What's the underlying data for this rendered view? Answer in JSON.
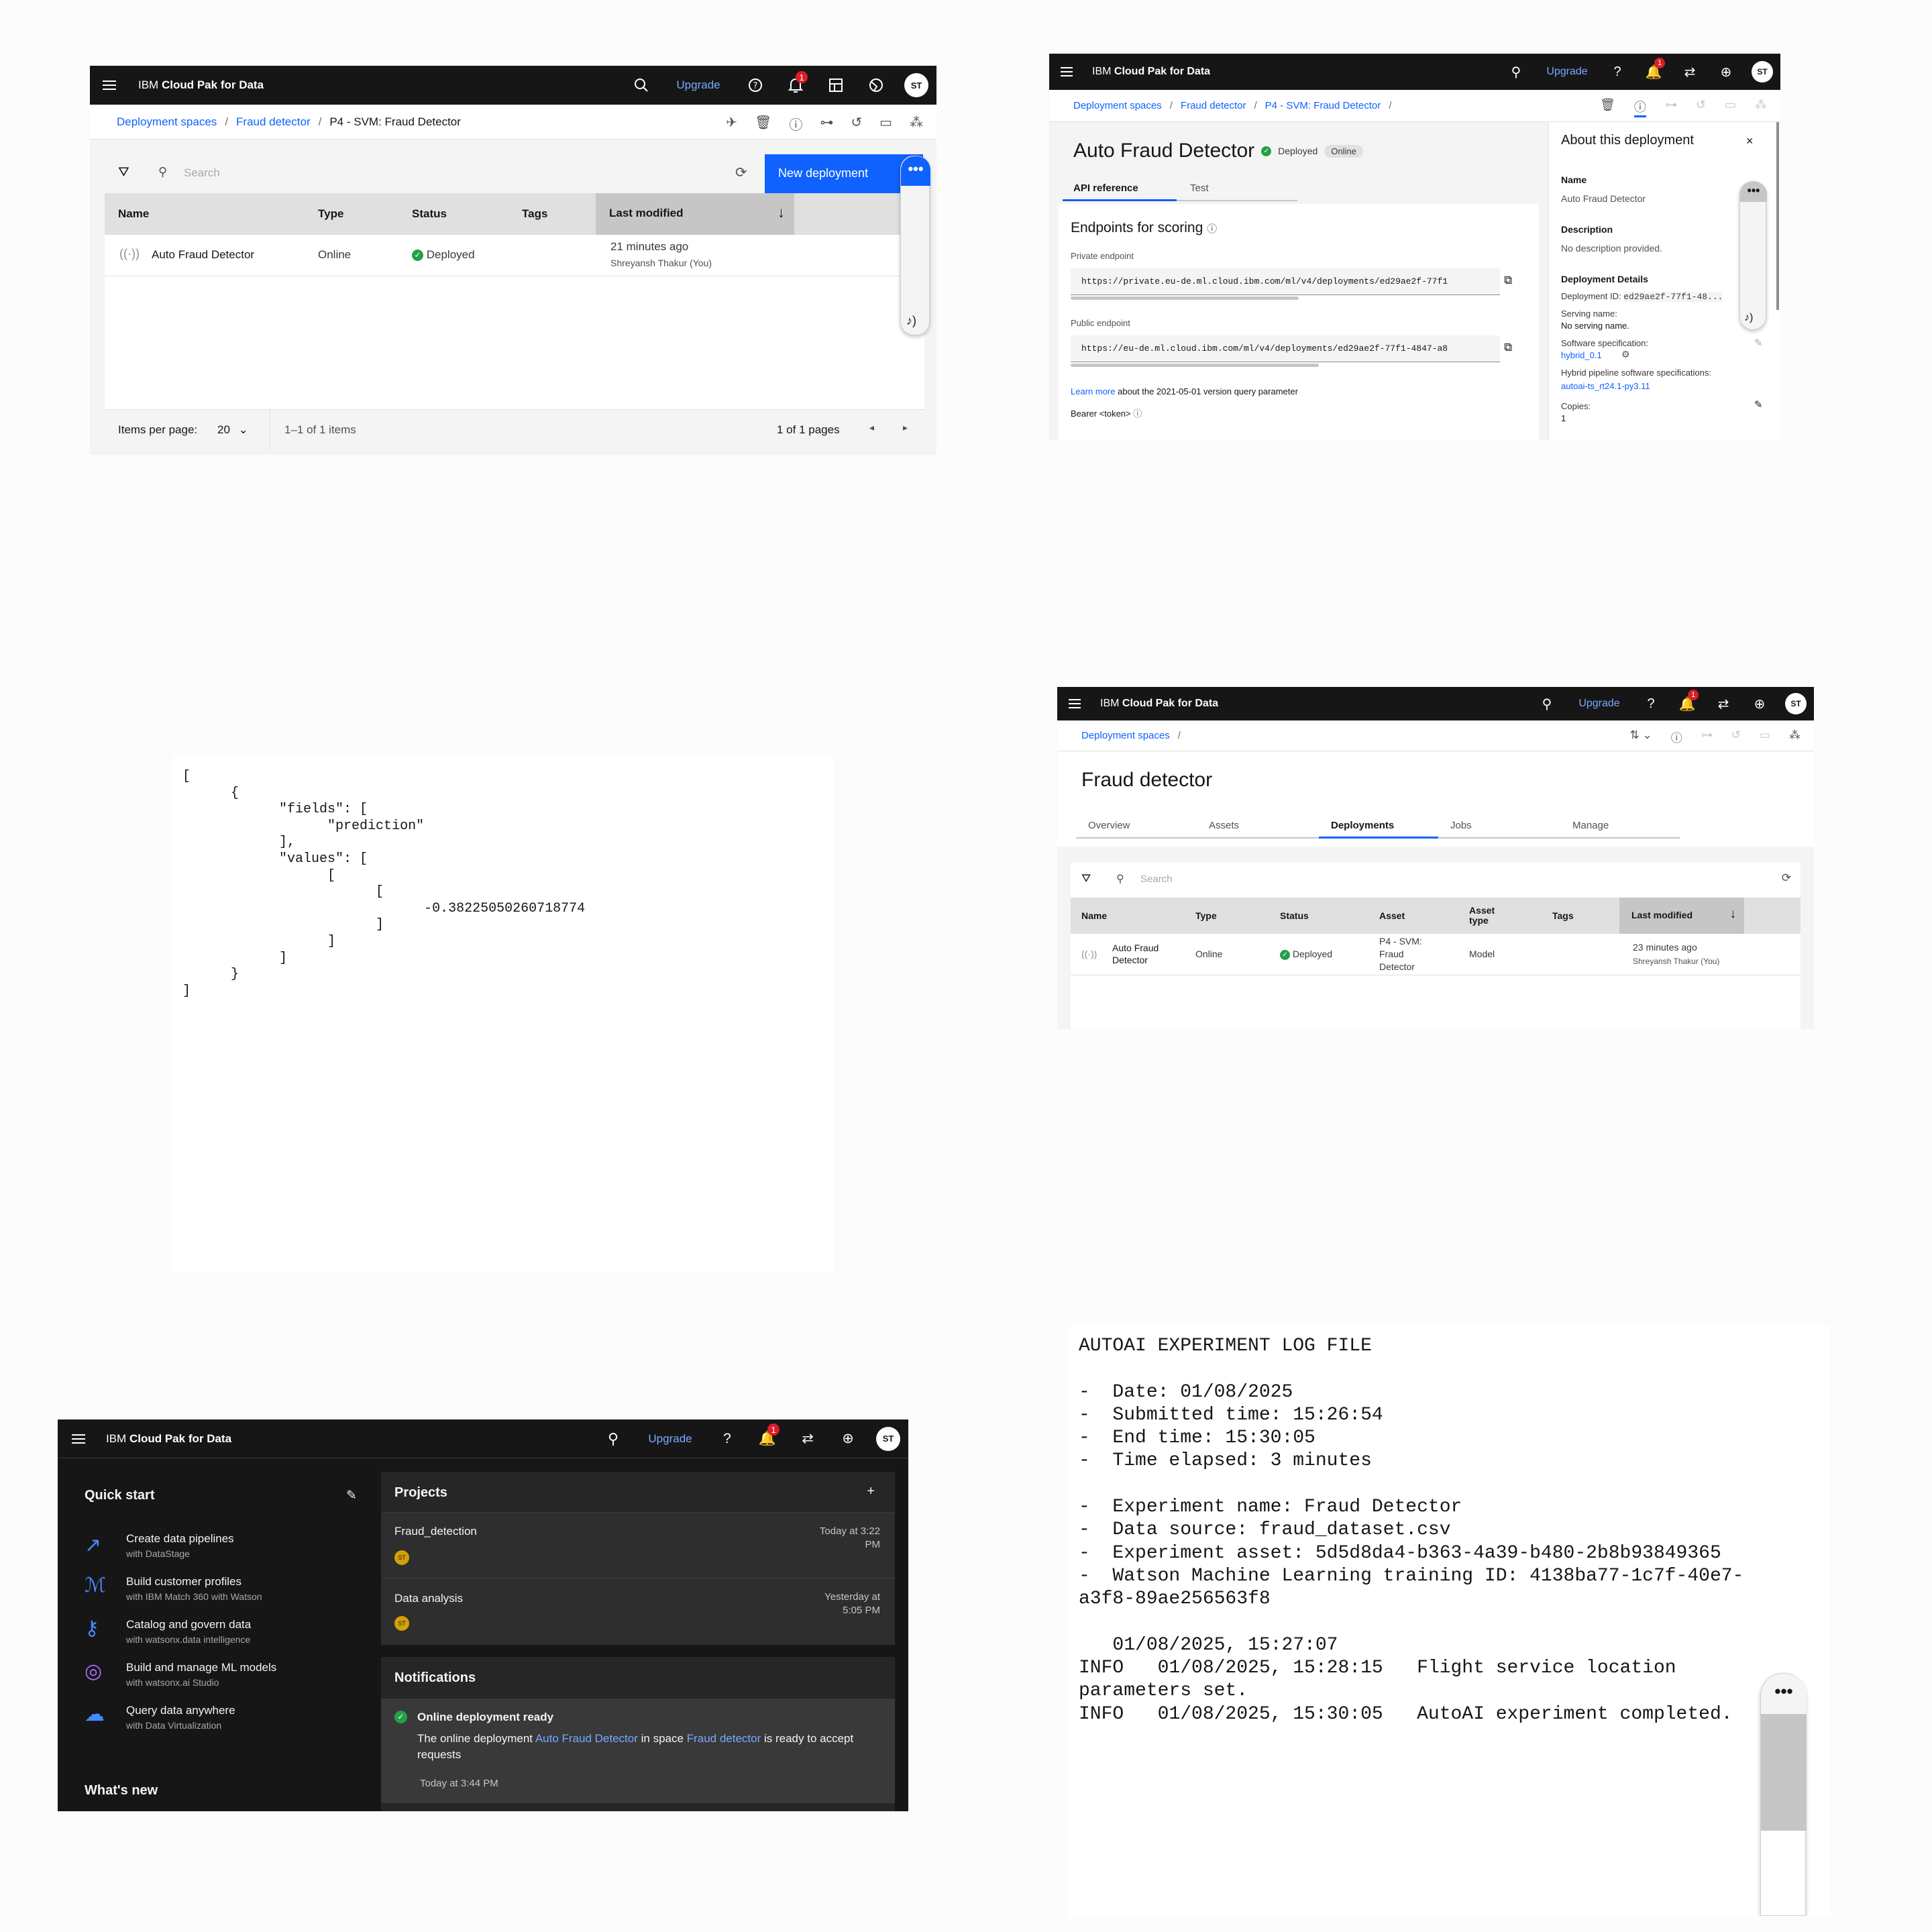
{
  "header": {
    "brand_prefix": "IBM",
    "brand_name": "Cloud Pak for Data",
    "upgrade_label": "Upgrade",
    "notification_count": "1",
    "avatar_initials": "ST"
  },
  "panel1": {
    "breadcrumb": [
      "Deployment spaces",
      "Fraud detector",
      "P4 - SVM: Fraud Detector"
    ],
    "search_placeholder": "Search",
    "new_deployment_label": "New deployment",
    "columns": [
      "Name",
      "Type",
      "Status",
      "Tags",
      "Last modified"
    ],
    "row": {
      "name": "Auto Fraud Detector",
      "type": "Online",
      "status": "Deployed",
      "modified": "21 minutes ago",
      "modified_by": "Shreyansh Thakur (You)"
    },
    "items_per_page_label": "Items per page:",
    "items_per_page_value": "20",
    "range_label": "1–1 of 1 items",
    "pages_label": "1 of 1 pages"
  },
  "panel2": {
    "breadcrumb": [
      "Deployment spaces",
      "Fraud detector",
      "P4 - SVM: Fraud Detector"
    ],
    "title": "Auto Fraud Detector",
    "status": "Deployed",
    "mode_tag": "Online",
    "tabs": [
      "API reference",
      "Test"
    ],
    "endpoints_heading": "Endpoints for scoring",
    "private_label": "Private endpoint",
    "private_url": "https://private.eu-de.ml.cloud.ibm.com/ml/v4/deployments/ed29ae2f-77f1",
    "public_label": "Public endpoint",
    "public_url": "https://eu-de.ml.cloud.ibm.com/ml/v4/deployments/ed29ae2f-77f1-4847-a8",
    "learn_more": "Learn more",
    "learn_more_rest": "about the 2021-05-01 version query parameter",
    "bearer": "Bearer <token>",
    "about": {
      "heading": "About this deployment",
      "name_label": "Name",
      "name_value": "Auto Fraud Detector",
      "desc_label": "Description",
      "desc_value": "No description provided.",
      "details_label": "Deployment Details",
      "id_label": "Deployment ID:",
      "id_value": "ed29ae2f-77f1-48...",
      "serving_label": "Serving name:",
      "serving_value": "No serving name.",
      "software_label": "Software specification:",
      "software_value": "hybrid_0.1",
      "hybrid_label": "Hybrid pipeline software specifications:",
      "hybrid_value": "autoai-ts_rt24.1-py3.11",
      "copies_label": "Copies:",
      "copies_value": "1"
    }
  },
  "panel3": {
    "json_text": "[\n\t{\n\t\t\"fields\": [\n\t\t\t\"prediction\"\n\t\t],\n\t\t\"values\": [\n\t\t\t[\n\t\t\t\t[\n\t\t\t\t\t-0.38225050260718774\n\t\t\t\t]\n\t\t\t]\n\t\t]\n\t}\n]"
  },
  "panel4": {
    "breadcrumb": [
      "Deployment spaces"
    ],
    "title": "Fraud detector",
    "tabs": [
      "Overview",
      "Assets",
      "Deployments",
      "Jobs",
      "Manage"
    ],
    "active_tab": "Deployments",
    "search_placeholder": "Search",
    "columns": [
      "Name",
      "Type",
      "Status",
      "Asset",
      "Asset type",
      "Tags",
      "Last modified"
    ],
    "row": {
      "name": "Auto Fraud Detector",
      "type": "Online",
      "status": "Deployed",
      "asset": "P4 - SVM: Fraud Detector",
      "asset_type": "Model",
      "modified": "23 minutes ago",
      "modified_by": "Shreyansh Thakur (You)"
    }
  },
  "panel5": {
    "quick_start_title": "Quick start",
    "quick_items": [
      {
        "title": "Create data pipelines",
        "sub": "with DataStage"
      },
      {
        "title": "Build customer profiles",
        "sub": "with IBM Match 360 with Watson"
      },
      {
        "title": "Catalog and govern data",
        "sub": "with watsonx.data intelligence"
      },
      {
        "title": "Build and manage ML models",
        "sub": "with watsonx.ai Studio"
      },
      {
        "title": "Query data anywhere",
        "sub": "with Data Virtualization"
      }
    ],
    "whats_new": "What's new",
    "projects_title": "Projects",
    "projects": [
      {
        "name": "Fraud_detection",
        "time": "Today at 3:22 PM",
        "avatar": "ST"
      },
      {
        "name": "Data analysis",
        "time": "Yesterday at 5:05 PM",
        "avatar": "ST"
      }
    ],
    "notifications_title": "Notifications",
    "notification": {
      "title": "Online deployment ready",
      "text1": "The online deployment",
      "link1": "Auto Fraud Detector",
      "text2": "in space",
      "link2": "Fraud detector",
      "text3": "is ready to accept requests",
      "time": "Today at 3:44 PM"
    }
  },
  "panel6": {
    "log_text": "AUTOAI EXPERIMENT LOG FILE\n\n-  Date: 01/08/2025\n-  Submitted time: 15:26:54\n-  End time: 15:30:05\n-  Time elapsed: 3 minutes\n\n-  Experiment name: Fraud Detector\n-  Data source: fraud_dataset.csv\n-  Experiment asset: 5d5d8da4-b363-4a39-b480-2b8b93849365\n-  Watson Machine Learning training ID: 4138ba77-1c7f-40e7-\na3f8-89ae256563f8\n\n   01/08/2025, 15:27:07\nINFO   01/08/2025, 15:28:15   Flight service location\nparameters set.\nINFO   01/08/2025, 15:30:05   AutoAI experiment completed."
  }
}
